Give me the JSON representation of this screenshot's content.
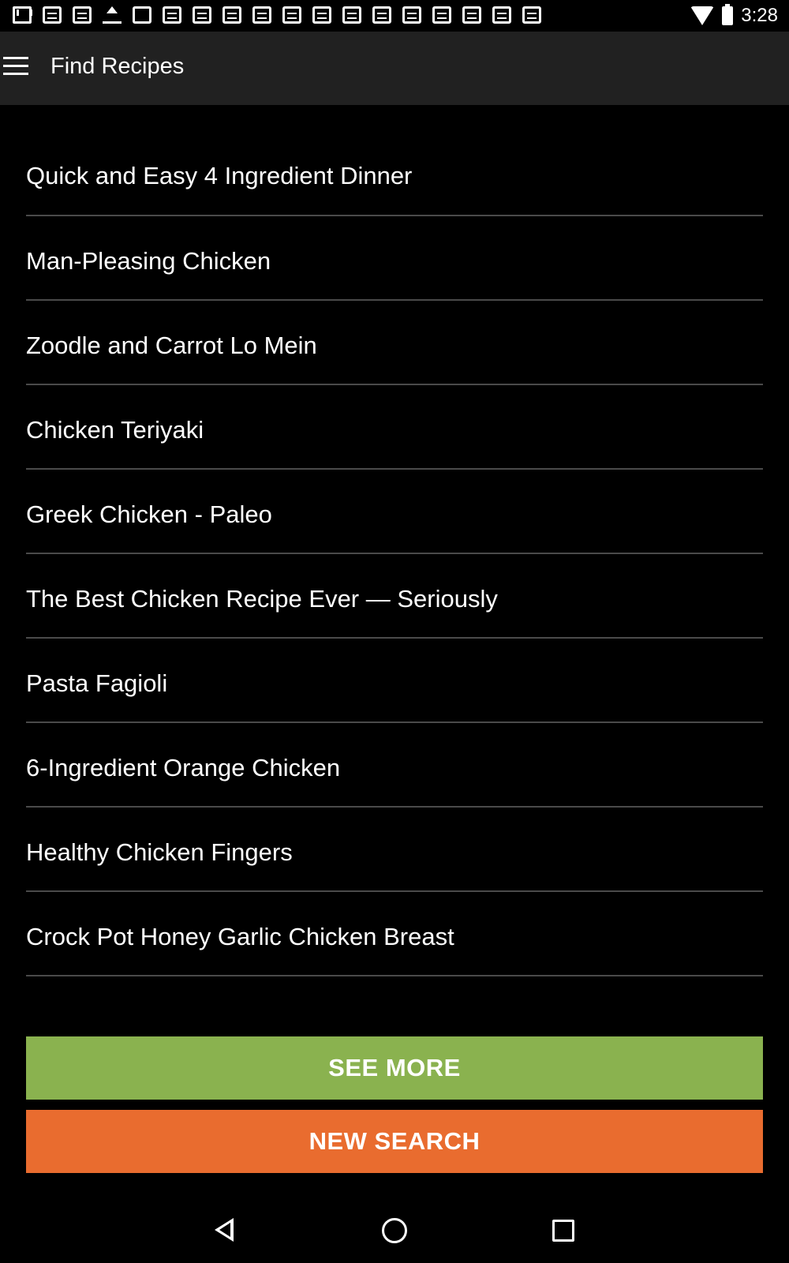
{
  "status_bar": {
    "time": "3:28",
    "notification_icons": [
      "gmail-icon",
      "news-icon",
      "news-icon",
      "upload-icon",
      "image-icon",
      "news-icon",
      "document-icon",
      "document-icon",
      "news-icon",
      "document-icon",
      "document-icon",
      "document-icon",
      "news-icon",
      "document-icon",
      "document-icon",
      "document-icon",
      "document-icon",
      "document-icon"
    ],
    "right_icons": [
      "wifi-icon",
      "battery-icon"
    ]
  },
  "app_bar": {
    "title": "Find Recipes",
    "menu_icon": "hamburger-menu-icon"
  },
  "recipes": [
    "Quick and Easy 4 Ingredient Dinner",
    "Man-Pleasing Chicken",
    "Zoodle and Carrot Lo Mein",
    "Chicken Teriyaki",
    "Greek Chicken - Paleo",
    "The Best Chicken Recipe Ever — Seriously",
    "Pasta Fagioli",
    "6-Ingredient Orange Chicken",
    "Healthy Chicken Fingers",
    "Crock Pot Honey Garlic Chicken Breast"
  ],
  "buttons": {
    "see_more": "SEE MORE",
    "new_search": "NEW SEARCH"
  },
  "colors": {
    "app_bar_bg": "#212121",
    "see_more_bg": "#8ab24f",
    "new_search_bg": "#e96c2f",
    "divider": "#4a4a4a"
  },
  "nav_bar": {
    "icons": [
      "back-icon",
      "home-icon",
      "recent-apps-icon"
    ]
  }
}
